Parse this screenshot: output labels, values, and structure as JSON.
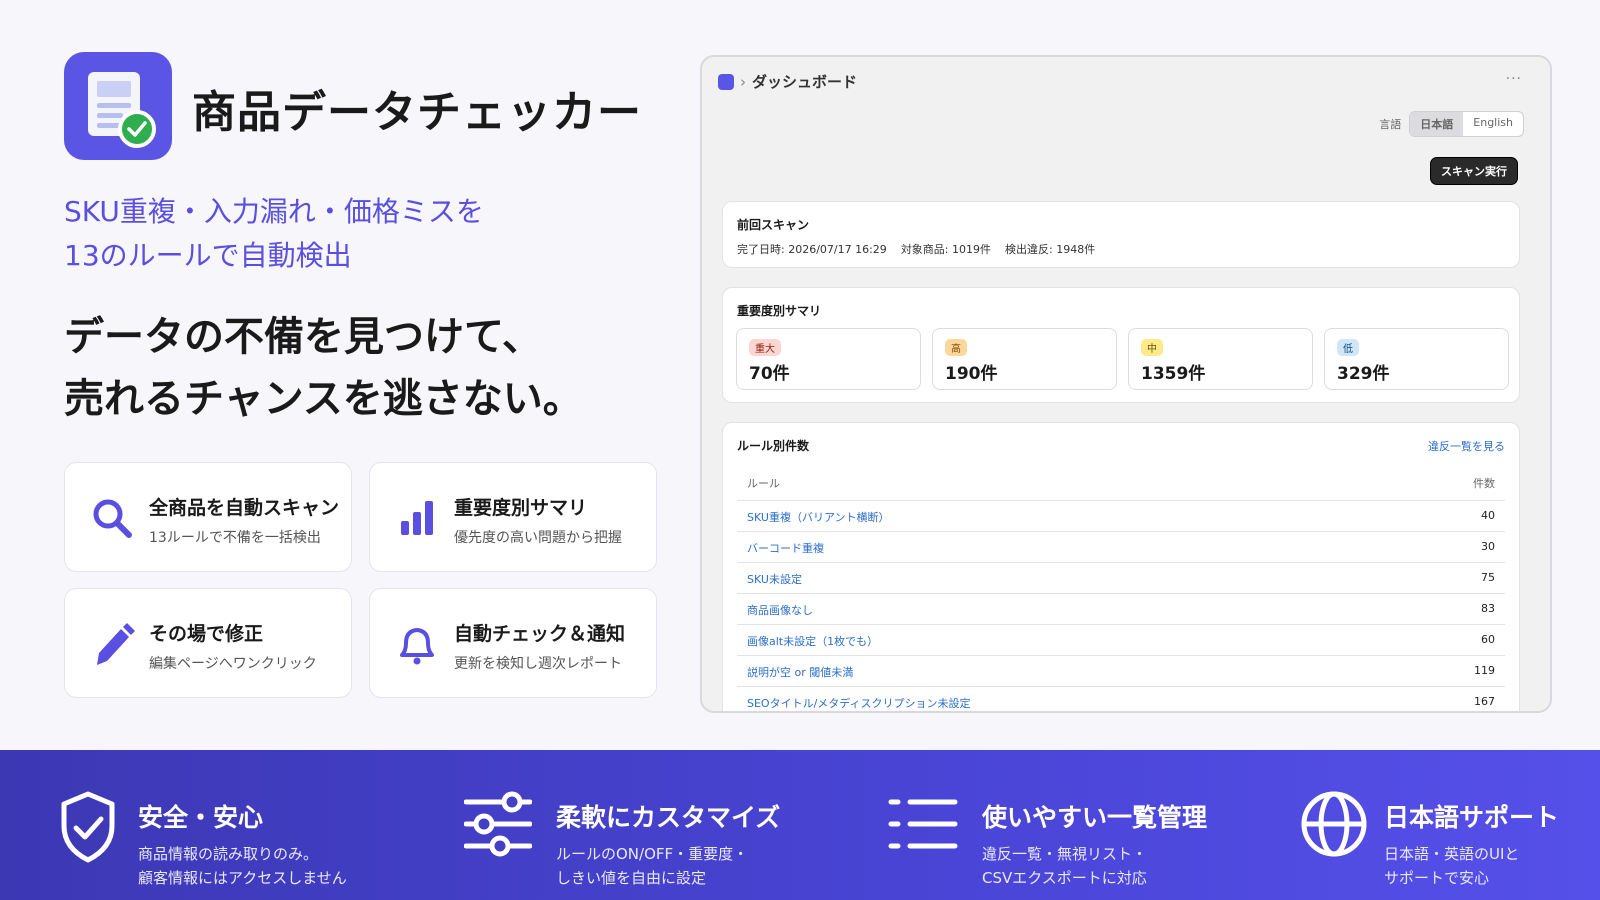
{
  "app": {
    "title": "商品データチェッカー",
    "subtitle_line1": "SKU重複・入力漏れ・価格ミスを",
    "subtitle_line2": "13のルールで自動検出",
    "headline_line1": "データの不備を見つけて、",
    "headline_line2": "売れるチャンスを逃さない。"
  },
  "features": [
    {
      "title": "全商品を自動スキャン",
      "desc": "13ルールで不備を一括検出",
      "icon": "search-icon"
    },
    {
      "title": "重要度別サマリ",
      "desc": "優先度の高い問題から把握",
      "icon": "bar-chart-icon"
    },
    {
      "title": "その場で修正",
      "desc": "編集ページへワンクリック",
      "icon": "pencil-icon"
    },
    {
      "title": "自動チェック＆通知",
      "desc": "更新を検知し週次レポート",
      "icon": "bell-icon"
    }
  ],
  "dashboard": {
    "breadcrumb": "ダッシュボード",
    "more": "···",
    "language_label": "言語",
    "languages": [
      "日本語",
      "English"
    ],
    "selected_language": "日本語",
    "scan_button": "スキャン実行",
    "last_scan": {
      "title": "前回スキャン",
      "completed": "完了日時: 2026/07/17 16:29",
      "products": "対象商品: 1019件",
      "violations": "検出違反: 1948件"
    },
    "severity": {
      "title": "重要度別サマリ",
      "items": [
        {
          "label": "重大",
          "count": "70件",
          "color": "#fcd6d3"
        },
        {
          "label": "高",
          "count": "190件",
          "color": "#ffd79d"
        },
        {
          "label": "中",
          "count": "1359件",
          "color": "#ffea8a"
        },
        {
          "label": "低",
          "count": "329件",
          "color": "#cfe6fb"
        }
      ]
    },
    "rules": {
      "title": "ルール別件数",
      "link": "違反一覧を見る",
      "col_rule": "ルール",
      "col_count": "件数",
      "rows": [
        {
          "name": "SKU重複（バリアント横断）",
          "count": "40"
        },
        {
          "name": "バーコード重複",
          "count": "30"
        },
        {
          "name": "SKU未設定",
          "count": "75"
        },
        {
          "name": "商品画像なし",
          "count": "83"
        },
        {
          "name": "画像alt未設定（1枚でも）",
          "count": "60"
        },
        {
          "name": "説明が空 or 閾値未満",
          "count": "119"
        },
        {
          "name": "SEOタイトル/メタディスクリプション未設定",
          "count": "167"
        }
      ]
    }
  },
  "bottom": [
    {
      "title": "安全・安心",
      "line1": "商品情報の読み取りのみ。",
      "line2": "顧客情報にはアクセスしません",
      "icon": "shield-check-icon"
    },
    {
      "title": "柔軟にカスタマイズ",
      "line1": "ルールのON/OFF・重要度・",
      "line2": "しきい値を自由に設定",
      "icon": "sliders-icon"
    },
    {
      "title": "使いやすい一覧管理",
      "line1": "違反一覧・無視リスト・",
      "line2": "CSVエクスポートに対応",
      "icon": "list-icon"
    },
    {
      "title": "日本語サポート",
      "line1": "日本語・英語のUIと",
      "line2": "サポートで安心",
      "icon": "globe-icon"
    }
  ],
  "colors": {
    "brand": "#5b55e6",
    "accent_text": "#5a4fe0",
    "link": "#2c6ecb",
    "band_start": "#3c38b4",
    "band_end": "#5650ea"
  }
}
